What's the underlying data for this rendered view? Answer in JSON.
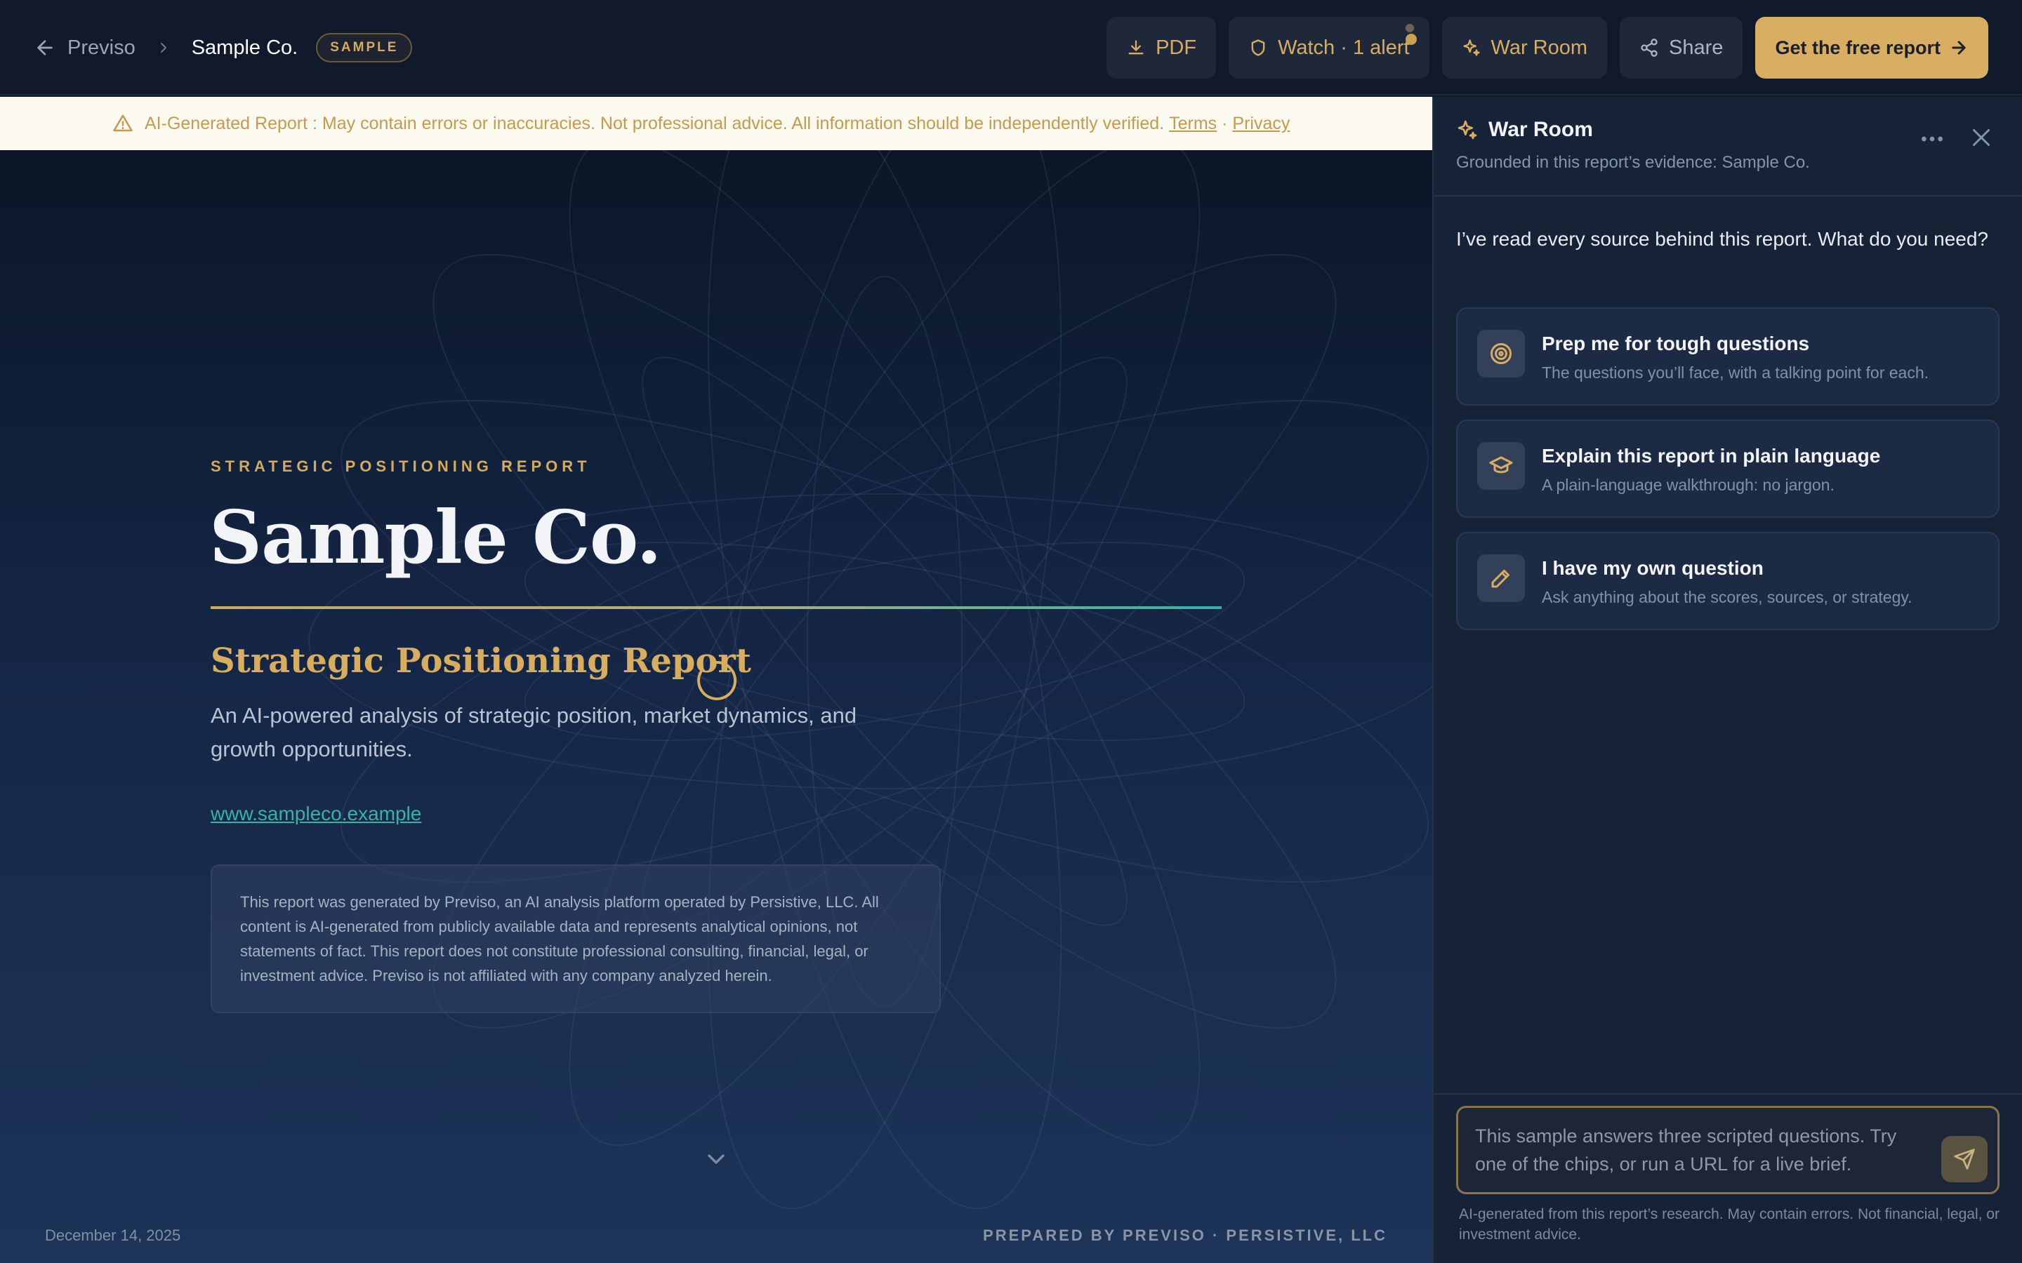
{
  "breadcrumb": {
    "app": "Previso",
    "company": "Sample Co.",
    "badge": "SAMPLE"
  },
  "toolbar": {
    "pdf": "PDF",
    "watch": "Watch · 1 alert",
    "war_room": "War Room",
    "share": "Share",
    "cta": "Get the free report"
  },
  "banner": {
    "text": "AI-Generated Report : May contain errors or inaccuracies. Not professional advice. All information should be independently verified.",
    "terms": "Terms",
    "sep": "·",
    "privacy": "Privacy"
  },
  "hero": {
    "eyebrow": "STRATEGIC POSITIONING REPORT",
    "title": "Sample Co.",
    "subtitle": "Strategic Positioning Report",
    "description": "An AI-powered analysis of strategic position, market dynamics, and growth opportunities.",
    "website": "www.sampleco.example",
    "disclaimer": "This report was generated by Previso, an AI analysis platform operated by Persistive, LLC. All content is AI-generated from publicly available data and represents analytical opinions, not statements of fact. This report does not constitute professional consulting, financial, legal, or investment advice. Previso is not affiliated with any company analyzed herein.",
    "date": "December 14, 2025",
    "prepared_by": "PREPARED BY PREVISO · PERSISTIVE, LLC"
  },
  "war_room": {
    "title": "War Room",
    "subtitle": "Grounded in this report’s evidence: Sample Co.",
    "intro": "I’ve read every source behind this report. What do you need?",
    "chips": [
      {
        "title": "Prep me for tough questions",
        "desc": "The questions you’ll face, with a talking point for each.",
        "icon": "target-icon"
      },
      {
        "title": "Explain this report in plain language",
        "desc": "A plain-language walkthrough: no jargon.",
        "icon": "graduation-cap-icon"
      },
      {
        "title": "I have my own question",
        "desc": "Ask anything about the scores, sources, or strategy.",
        "icon": "pencil-icon"
      }
    ],
    "input_placeholder": "This sample answers three scripted questions. Try one of the chips, or run a URL for a live brief.",
    "footer_note": "AI-generated from this report’s research. May contain errors. Not financial, legal, or investment advice."
  },
  "colors": {
    "accent_gold": "#d8ae62",
    "teal": "#37b2a3",
    "navy": "#101a2c"
  }
}
